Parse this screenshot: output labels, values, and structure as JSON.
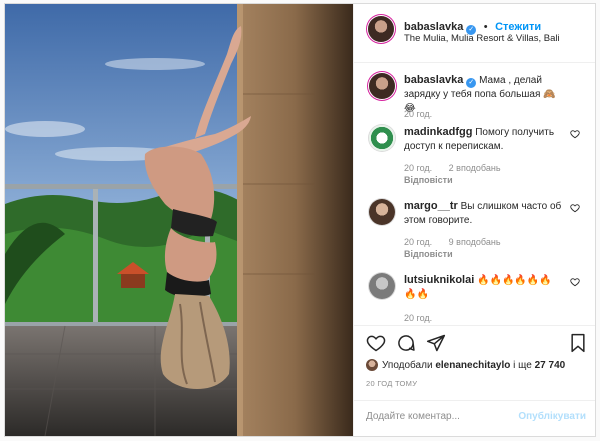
{
  "post": {
    "username": "babaslavka",
    "follow_label": "Стежити",
    "dot": "•",
    "location": "The Mulia, Mulia Resort & Villas, Bali"
  },
  "caption": {
    "username": "babaslavka",
    "text": "Мама , делай зарядку у тебя попа большая 🙈😂",
    "time": "20 год."
  },
  "comments": [
    {
      "username": "madinkadfgg",
      "text": "Помогу получить доступ к перепискам.",
      "time": "20 год.",
      "likes": "2 вподобань",
      "reply": "Відповісти"
    },
    {
      "username": "margo__tr",
      "text": "Вы слишком часто об этом говорите.",
      "time": "20 год.",
      "likes": "9 вподобань",
      "reply": "Відповісти"
    },
    {
      "username": "lutsiuknikolai",
      "text": "🔥🔥🔥🔥🔥🔥🔥🔥",
      "time": "20 год.",
      "likes": "",
      "reply": ""
    }
  ],
  "likes": {
    "prefix": "Уподобали",
    "user": "elenanechitaylo",
    "middle": "і ще",
    "count": "27 740"
  },
  "time_ago": "20 ГОД ТОМУ",
  "add_comment": {
    "placeholder": "Додайте коментар...",
    "publish": "Опублікувати"
  },
  "colors": {
    "accent": "#0095f6",
    "verified": "#3897f0",
    "muted": "#8e8e8e"
  },
  "icons": [
    "heart-icon",
    "comment-icon",
    "share-icon",
    "bookmark-icon",
    "verified-icon"
  ]
}
